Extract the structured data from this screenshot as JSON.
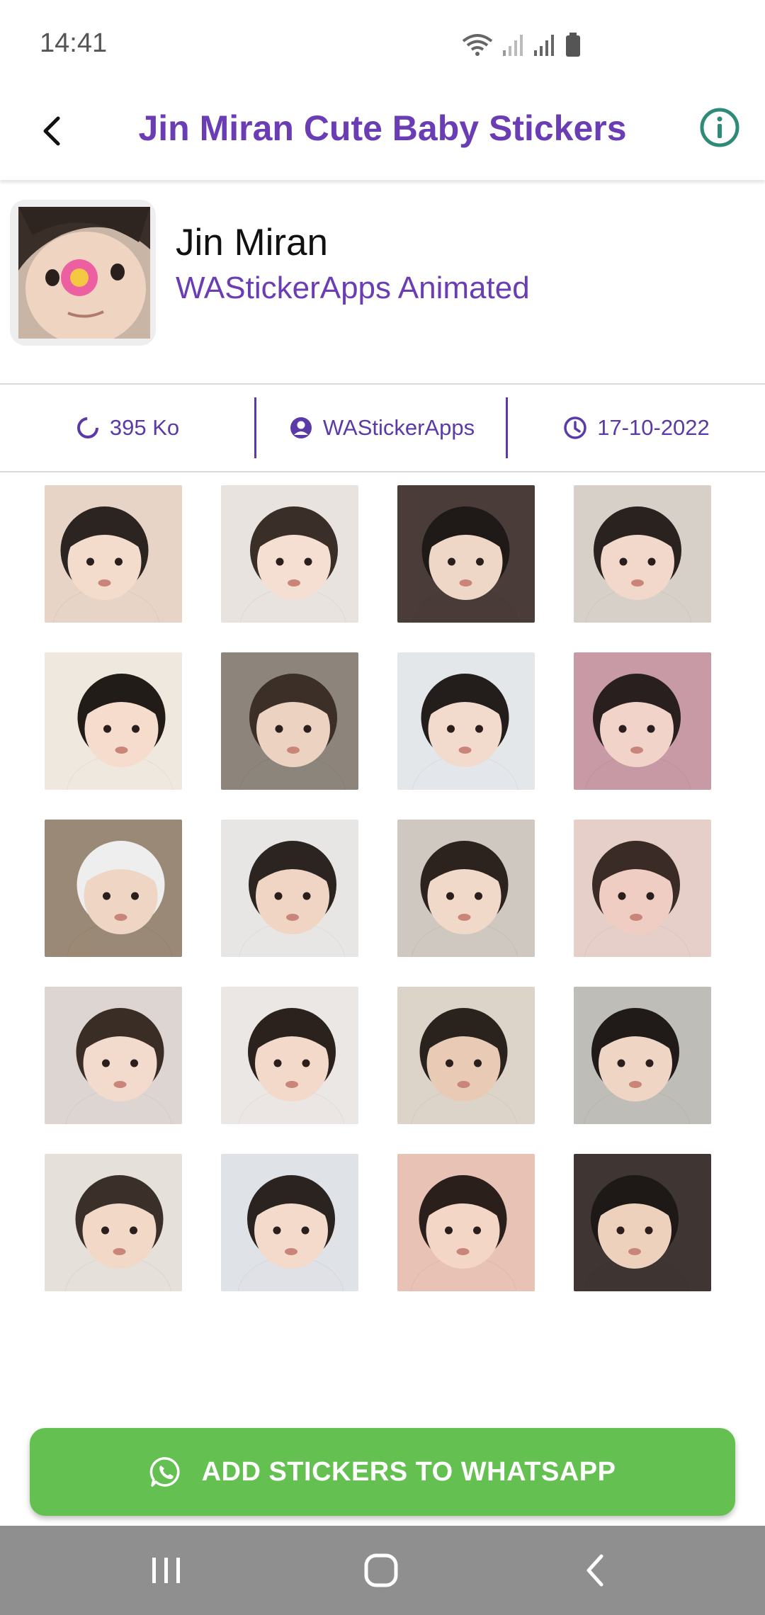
{
  "status_bar": {
    "time": "14:41"
  },
  "app_bar": {
    "title": "Jin Miran Cute Baby Stickers"
  },
  "pack": {
    "name": "Jin Miran",
    "type": "WAStickerApps Animated"
  },
  "info": {
    "size": "395 Ko",
    "publisher": "WAStickerApps",
    "date": "17-10-2022"
  },
  "stickers": [
    {
      "bg": "#e7d4c6",
      "face": "#f3dccc",
      "hair": "#2b2421"
    },
    {
      "bg": "#e9e3df",
      "face": "#f4dfd2",
      "hair": "#3a2e28"
    },
    {
      "bg": "#4a3d39",
      "face": "#efd7c7",
      "hair": "#1f1a18"
    },
    {
      "bg": "#d7d0c9",
      "face": "#f1d8ca",
      "hair": "#2a221e"
    },
    {
      "bg": "#efe8df",
      "face": "#f5dccd",
      "hair": "#221c19"
    },
    {
      "bg": "#8d857c",
      "face": "#ecd3c1",
      "hair": "#3b2f27"
    },
    {
      "bg": "#e3e7ea",
      "face": "#f2dbcc",
      "hair": "#231d1b"
    },
    {
      "bg": "#c79aa6",
      "face": "#f1d3ca",
      "hair": "#2a1f1f"
    },
    {
      "bg": "#9b8977",
      "face": "#eed5c4",
      "hair": "#eeeeee"
    },
    {
      "bg": "#e8e6e4",
      "face": "#f0d5c5",
      "hair": "#2c2420"
    },
    {
      "bg": "#cfc8c1",
      "face": "#f1d9c9",
      "hair": "#2c231f"
    },
    {
      "bg": "#e6cfc9",
      "face": "#f0cdc2",
      "hair": "#3a2b26"
    },
    {
      "bg": "#ddd5d1",
      "face": "#f2dacc",
      "hair": "#3a2d26"
    },
    {
      "bg": "#ebe7e4",
      "face": "#f2d9ca",
      "hair": "#2b221e"
    },
    {
      "bg": "#dcd4c9",
      "face": "#e9cbb5",
      "hair": "#2a221d"
    },
    {
      "bg": "#bfbdb7",
      "face": "#efd5c3",
      "hair": "#201b19"
    },
    {
      "bg": "#e5e0d9",
      "face": "#f1d8c7",
      "hair": "#3a2f29"
    },
    {
      "bg": "#dfe2e6",
      "face": "#f3dacb",
      "hair": "#2a231f"
    },
    {
      "bg": "#e8c2b5",
      "face": "#f3d6c6",
      "hair": "#2a1f1b"
    },
    {
      "bg": "#3f3532",
      "face": "#eed1bd",
      "hair": "#1e1816"
    }
  ],
  "add_button": {
    "label": "ADD STICKERS TO WHATSAPP"
  },
  "colors": {
    "accent": "#6a3db4",
    "info_text": "#5b3aa8",
    "info_icon": "#2e8b78",
    "whatsapp_green": "#64c151",
    "nav_bar": "#8f8f8f"
  },
  "icons": {
    "back": "back-arrow-icon",
    "info": "info-circle-icon",
    "size": "loading-ring-icon",
    "publisher": "person-circle-icon",
    "date": "clock-icon",
    "whatsapp": "whatsapp-icon"
  }
}
